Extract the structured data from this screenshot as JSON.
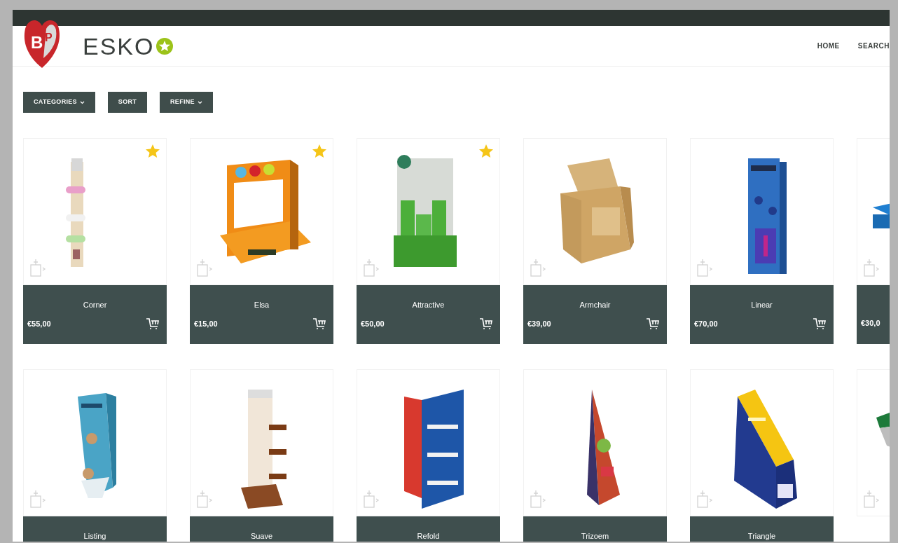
{
  "header": {
    "logo_letters": [
      "B",
      "P"
    ],
    "brand": "ESKO",
    "nav": [
      {
        "label": "HOME"
      },
      {
        "label": "SEARCH"
      }
    ]
  },
  "filters": [
    {
      "label": "CATEGORIES",
      "dropdown": true
    },
    {
      "label": "SORT",
      "dropdown": false
    },
    {
      "label": "REFINE",
      "dropdown": true
    }
  ],
  "products": [
    {
      "name": "Corner",
      "price": "€55,00",
      "favorite": true
    },
    {
      "name": "Elsa",
      "price": "€15,00",
      "favorite": true
    },
    {
      "name": "Attractive",
      "price": "€50,00",
      "favorite": true
    },
    {
      "name": "Armchair",
      "price": "€39,00",
      "favorite": false
    },
    {
      "name": "Linear",
      "price": "€70,00",
      "favorite": false
    },
    {
      "price": "€30,0",
      "favorite": false
    },
    {
      "name": "Listing",
      "favorite": false
    },
    {
      "name": "Suave",
      "favorite": false
    },
    {
      "name": "Refold",
      "favorite": false
    },
    {
      "name": "Trizoem",
      "favorite": false
    },
    {
      "name": "Triangle",
      "favorite": false
    },
    {
      "favorite": false
    }
  ]
}
